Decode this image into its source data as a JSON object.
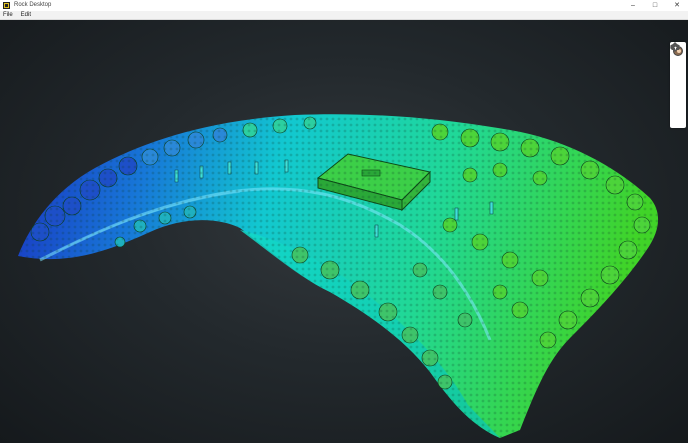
{
  "window": {
    "title": "Rock Desktop",
    "controls": {
      "minimize": "–",
      "maximize": "□",
      "close": "✕"
    }
  },
  "menu": {
    "items": [
      {
        "label": "File"
      },
      {
        "label": "Edit"
      }
    ]
  },
  "toolbar": {
    "tools": [
      {
        "icon": "user-avatar-icon"
      },
      {
        "icon": "move-icon"
      },
      {
        "icon": "layers-icon"
      },
      {
        "icon": "eye-icon"
      },
      {
        "icon": "cloud-upload-icon"
      }
    ]
  },
  "viewport": {
    "content": "point-cloud-elevation",
    "colors": {
      "low": "#1a2fc0",
      "mid": "#12c8d0",
      "high": "#38d630",
      "background": "#23292d"
    }
  }
}
